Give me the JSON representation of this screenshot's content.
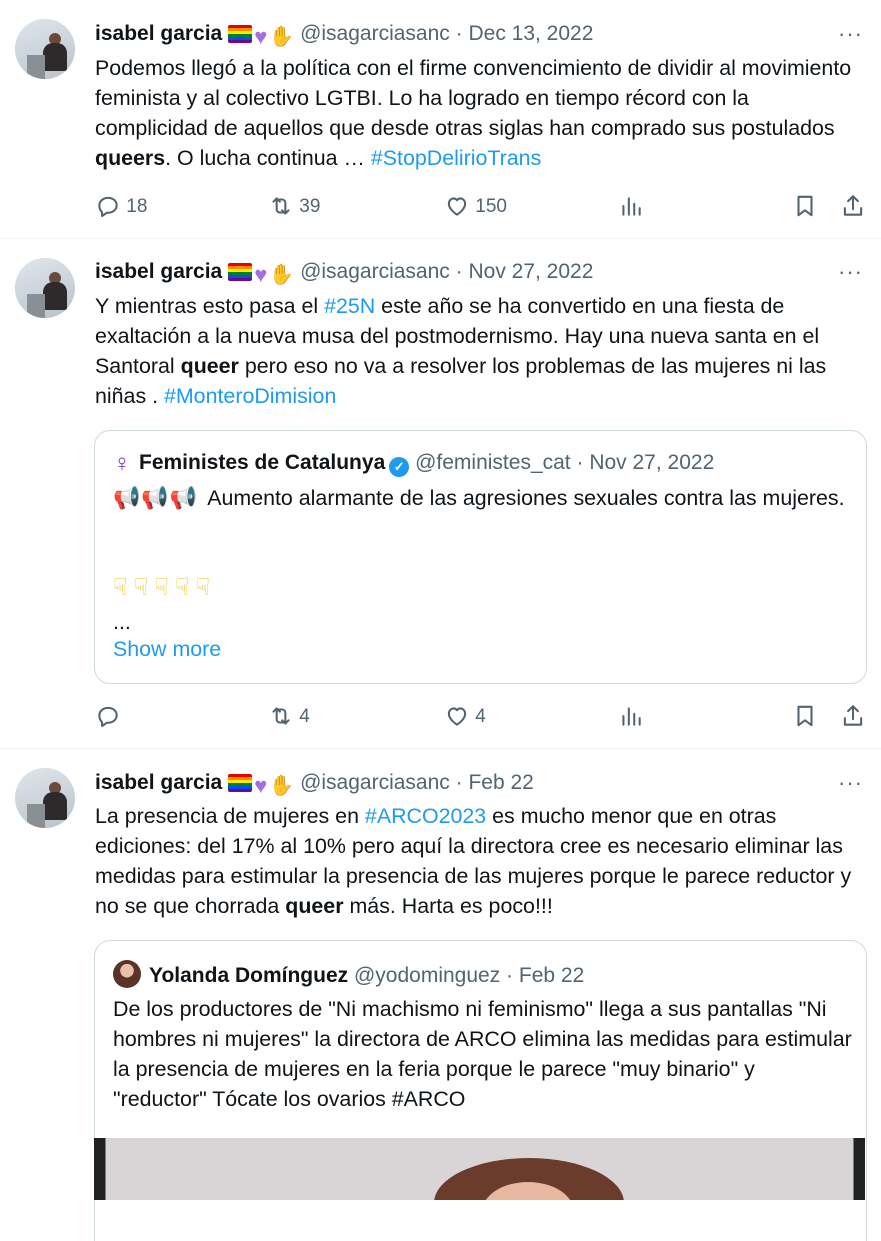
{
  "colors": {
    "link": "#1d9bf0",
    "muted": "#536471",
    "text": "#0f1419",
    "border": "#cfd9de"
  },
  "tweets": [
    {
      "name": "isabel garcia",
      "handle": "@isagarciasanc",
      "sep": "·",
      "date": "Dec 13, 2022",
      "more": "···",
      "text": {
        "p1": "Podemos llegó a la política con el firme convencimiento de dividir al movimiento feminista y al colectivo LGTBI. Lo ha logrado en tiempo récord con la complicidad de aquellos que desde otras siglas han comprado sus postulados ",
        "bold": "queers",
        "p2": ". O lucha continua … ",
        "hashtag": "#StopDelirioTrans"
      },
      "stats": {
        "replies": "18",
        "reposts": "39",
        "likes": "150"
      }
    },
    {
      "name": "isabel garcia",
      "handle": "@isagarciasanc",
      "sep": "·",
      "date": "Nov 27, 2022",
      "more": "···",
      "text": {
        "p1": "Y mientras esto pasa el ",
        "hashtag1": "#25N",
        "p2": " este año se ha convertido en una fiesta de exaltación a la nueva musa del postmodernismo. Hay una nueva santa en el Santoral ",
        "bold": "queer",
        "p3": " pero eso no va a resolver los problemas de las mujeres ni las niñas . ",
        "hashtag2": "#MonteroDimision"
      },
      "quote": {
        "name": "Feministes de Catalunya",
        "handle": "@feministes_cat",
        "sep": "·",
        "date": "Nov 27, 2022",
        "text": "Aumento alarmante de las agresiones sexuales contra las mujeres.",
        "ellipsis": "...",
        "show_more": "Show more"
      },
      "stats": {
        "replies": "",
        "reposts": "4",
        "likes": "4"
      }
    },
    {
      "name": "isabel garcia",
      "handle": "@isagarciasanc",
      "sep": "·",
      "date": "Feb 22",
      "more": "···",
      "text": {
        "p1": "La presencia de mujeres en ",
        "hashtag": "#ARCO2023",
        "p2": " es mucho menor que en otras ediciones: del 17% al 10% pero aquí la directora cree es necesario eliminar las medidas para estimular la presencia de las mujeres porque le parece reductor y no se que chorrada ",
        "bold": "queer",
        "p3": " más. Harta es poco!!!"
      },
      "quote": {
        "name": "Yolanda Domínguez",
        "handle": "@yodominguez",
        "sep": "·",
        "date": "Feb 22",
        "text": "De los productores de \"Ni machismo ni feminismo\" llega a sus pantallas \"Ni hombres ni mujeres\" la directora de ARCO elimina las medidas para estimular la presencia de mujeres en la feria porque le parece \"muy binario\" y \"reductor\" Tócate los ovarios #ARCO"
      }
    }
  ]
}
